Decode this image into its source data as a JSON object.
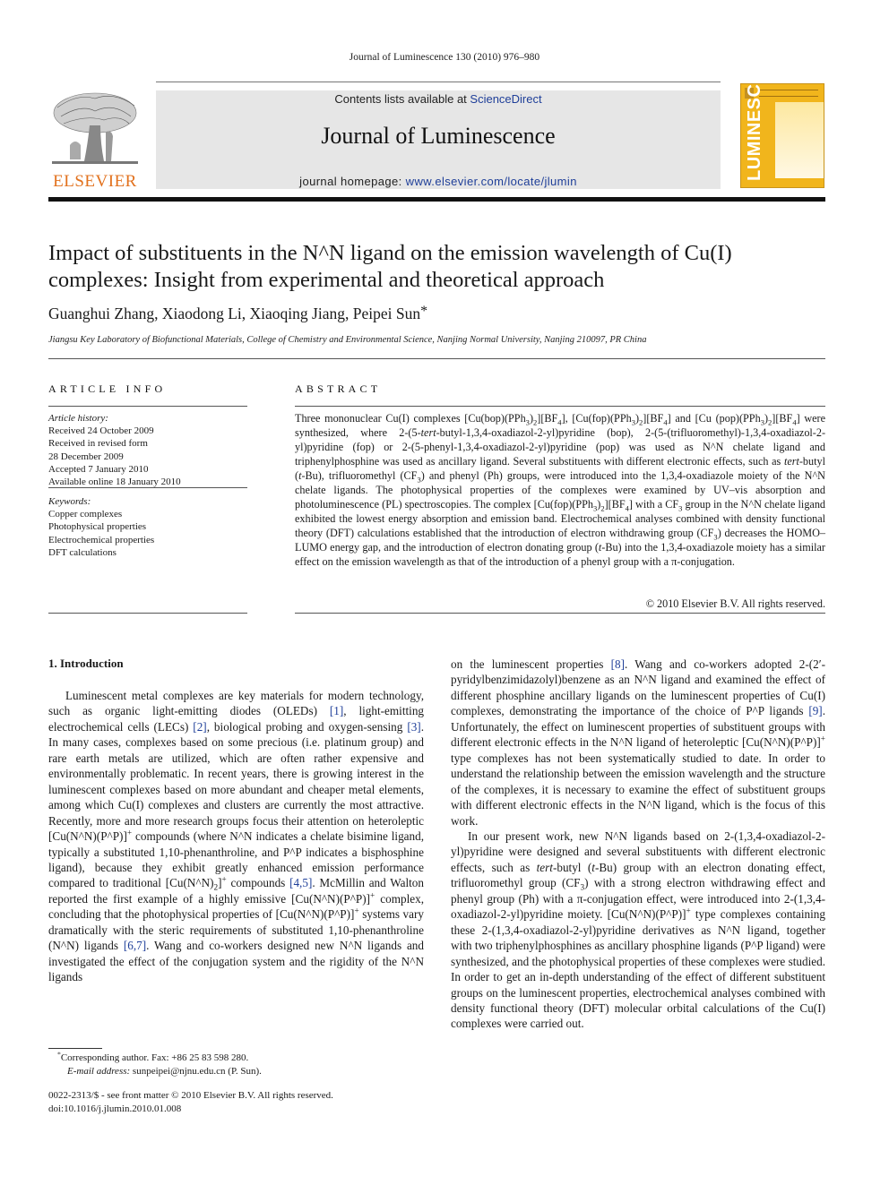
{
  "running_head": "Journal of Luminescence 130 (2010) 976–980",
  "header": {
    "publisher_word": "ELSEVIER",
    "contents_prefix": "Contents lists available at ",
    "contents_link": "ScienceDirect",
    "journal_name": "Journal of Luminescence",
    "homepage_prefix": "journal homepage: ",
    "homepage_link": "www.elsevier.com/locate/jlumin",
    "cover_title": "LUMINESCENCE",
    "colors": {
      "elsevier_orange": "#e2711d",
      "link_blue": "#1f3f99",
      "cover_yellow": "#f1b51c",
      "banner_gray": "#e6e6e6"
    }
  },
  "article": {
    "title_line1": "Impact of substituents in the N^N ligand on the emission wavelength of Cu(I)",
    "title_line2": "complexes: Insight from experimental and theoretical approach",
    "authors": "Guanghui Zhang, Xiaodong Li, Xiaoqing Jiang, Peipei Sun",
    "author_mark": "*",
    "affiliation": "Jiangsu Key Laboratory of Biofunctional Materials, College of Chemistry and Environmental Science, Nanjing Normal University, Nanjing 210097, PR China"
  },
  "article_info": {
    "heading": "ARTICLE INFO",
    "history_label": "Article history:",
    "history": [
      "Received 24 October 2009",
      "Received in revised form",
      "28 December 2009",
      "Accepted 7 January 2010",
      "Available online 18 January 2010"
    ],
    "keywords_label": "Keywords:",
    "keywords": [
      "Copper complexes",
      "Photophysical properties",
      "Electrochemical properties",
      "DFT calculations"
    ]
  },
  "abstract": {
    "heading": "ABSTRACT",
    "copyright": "© 2010 Elsevier B.V. All rights reserved.",
    "segments": {
      "s1": "Three mononuclear Cu(I) complexes [Cu(bop)(PPh",
      "s2": ")",
      "s3": "][BF",
      "s4": "], [Cu(fop)(PPh",
      "s5": "][BF",
      "s6": "] and [Cu (pop)(PPh",
      "s7": "][BF",
      "s8": "] were synthesized, where 2-(5-",
      "tert1": "tert",
      "s9": "-butyl-1,3,4-oxadiazol-2-yl)pyridine (bop), 2-(5-(trifluoromethyl)-1,3,4-oxadiazol-2-yl)pyridine (fop) or 2-(5-phenyl-1,3,4-oxadiazol-2-yl)pyridine (pop) was used as N^N chelate ligand and triphenylphosphine was used as ancillary ligand. Several substituents with different electronic effects, such as ",
      "tert2": "tert",
      "s10": "-butyl (",
      "t1": "t",
      "s11": "-Bu), trifluoromethyl (CF",
      "s12": ") and phenyl (Ph) groups, were introduced into the 1,3,4-oxadiazole moiety of the N^N chelate ligands. The photophysical properties of the complexes were examined by UV–vis absorption and photoluminescence (PL) spectroscopies. The complex [Cu(fop)(PPh",
      "s13": "][BF",
      "s14": "] with a CF",
      "s15": " group in the N^N chelate ligand exhibited the lowest energy absorption and emission band. Electrochemical analyses combined with density functional theory (DFT) calculations established that the introduction of electron withdrawing group (CF",
      "s16": ") decreases the HOMO–LUMO energy gap, and the introduction of electron donating group (",
      "t2": "t",
      "s17": "-Bu) into the 1,3,4-oxadiazole moiety has a similar effect on the emission wavelength as that of the introduction of a phenyl group with a π-conjugation.",
      "sub3": "3",
      "sub2": "2",
      "sub4": "4"
    }
  },
  "introduction": {
    "heading": "1.  Introduction",
    "left_col": {
      "p1a": "Luminescent metal complexes are key materials for modern technology, such as organic light-emitting diodes (OLEDs) ",
      "r1": "[1]",
      "p1b": ", light-emitting electrochemical cells (LECs) ",
      "r2": "[2]",
      "p1c": ", biological probing and oxygen-sensing ",
      "r3": "[3]",
      "p1d": ". In many cases, complexes based on some precious (i.e. platinum group) and rare earth metals are utilized, which are often rather expensive and environmentally problematic. In recent years, there is growing interest in the luminescent complexes based on more abundant and cheaper metal elements, among which Cu(I) complexes and clusters are currently the most attractive. Recently, more and more research groups focus their attention on heteroleptic [Cu(N^N)(P^P)]",
      "plus": "+",
      "p1e": " compounds (where N^N indicates a chelate bisimine ligand, typically a substituted 1,10-phenanthroline, and P^P indicates a bisphosphine ligand), because they exhibit greatly enhanced emission performance compared to traditional [Cu(N^N)",
      "sub2": "2",
      "p1f": "]",
      "p1g": " compounds ",
      "r45": "[4,5]",
      "p1h": ". McMillin and Walton reported the first example of a highly emissive [Cu(N^N)(P^P)]",
      "p1i": " complex, concluding that the photophysical properties of [Cu(N^N)(P^P)]",
      "p1j": " systems vary dramatically with the steric requirements of substituted 1,10-phenanthroline (N^N) ligands ",
      "r67": "[6,7]",
      "p1k": ". Wang and co-workers designed new N^N ligands and investigated the effect of the conjugation system and the rigidity of the N^N ligands"
    },
    "right_col": {
      "p1l": "on the luminescent properties ",
      "r8": "[8]",
      "p1m": ". Wang and co-workers adopted 2-(2′-pyridylbenzimidazolyl)benzene as an N^N ligand and examined the effect of different phosphine ancillary ligands on the luminescent properties of Cu(I) complexes, demonstrating the importance of the choice of P^P ligands ",
      "r9": "[9]",
      "p1n": ". Unfortunately, the effect on luminescent properties of substituent groups with different electronic effects in the N^N ligand of heteroleptic [Cu(N^N)(P^P)]",
      "p1o": " type complexes has not been systematically studied to date. In order to understand the relationship between the emission wavelength and the structure of the complexes, it is necessary to examine the effect of substituent groups with different electronic effects in the N^N ligand, which is the focus of this work.",
      "p2a": "In our present work, new N^N ligands based on 2-(1,3,4-oxadiazol-2-yl)pyridine were designed and several substituents with different electronic effects, such as ",
      "tert": "tert",
      "p2b": "-butyl (",
      "t": "t",
      "p2c": "-Bu) group with an electron donating effect, trifluoromethyl group (CF",
      "sub3": "3",
      "p2d": ") with a strong electron withdrawing effect and phenyl group (Ph) with a π-conjugation effect, were introduced into 2-(1,3,4-oxadiazol-2-yl)pyridine moiety. [Cu(N^N)(P^P)]",
      "plus": "+",
      "p2e": " type complexes containing these 2-(1,3,4-oxadiazol-2-yl)pyridine derivatives as N^N ligand, together with two triphenylphosphines as ancillary phosphine ligands (P^P ligand) were synthesized, and the photophysical properties of these complexes were studied. In order to get an in-depth understanding of the effect of different substituent groups on the luminescent properties, electrochemical analyses combined with density functional theory (DFT) molecular orbital calculations of the Cu(I) complexes were carried out."
    }
  },
  "footnotes": {
    "star": "*",
    "corresponding": "Corresponding author. Fax: +86 25 83 598 280.",
    "email_label": "E-mail address:",
    "email": "sunpeipei@njnu.edu.cn",
    "email_suffix": " (P. Sun).",
    "front_matter": "0022-2313/$ - see front matter © 2010 Elsevier B.V. All rights reserved.",
    "doi": "doi:10.1016/j.jlumin.2010.01.008"
  }
}
